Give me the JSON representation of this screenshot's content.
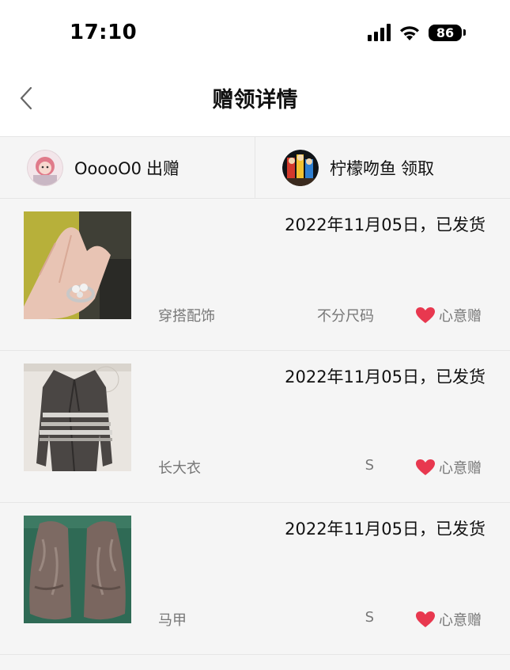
{
  "status_bar": {
    "time": "17:10",
    "battery": "86",
    "icons": [
      "signal-icon",
      "wifi-icon",
      "battery-icon"
    ]
  },
  "nav": {
    "back_icon": "chevron-left-icon",
    "title": "赠领详情"
  },
  "parties": {
    "giver": {
      "name": "OoooO0",
      "action": "出赠"
    },
    "receiver": {
      "name": "柠檬吻鱼",
      "action": "领取"
    }
  },
  "items": [
    {
      "date_status": "2022年11月05日，已发货",
      "category": "穿搭配饰",
      "size": "不分尺码",
      "tag": "心意赠"
    },
    {
      "date_status": "2022年11月05日，已发货",
      "category": "长大衣",
      "size": "S",
      "tag": "心意赠"
    },
    {
      "date_status": "2022年11月05日，已发货",
      "category": "马甲",
      "size": "S",
      "tag": "心意赠"
    }
  ],
  "colors": {
    "heart": "#e8384f",
    "background": "#f5f5f5",
    "header": "#ffffff",
    "muted_text": "#777777"
  }
}
